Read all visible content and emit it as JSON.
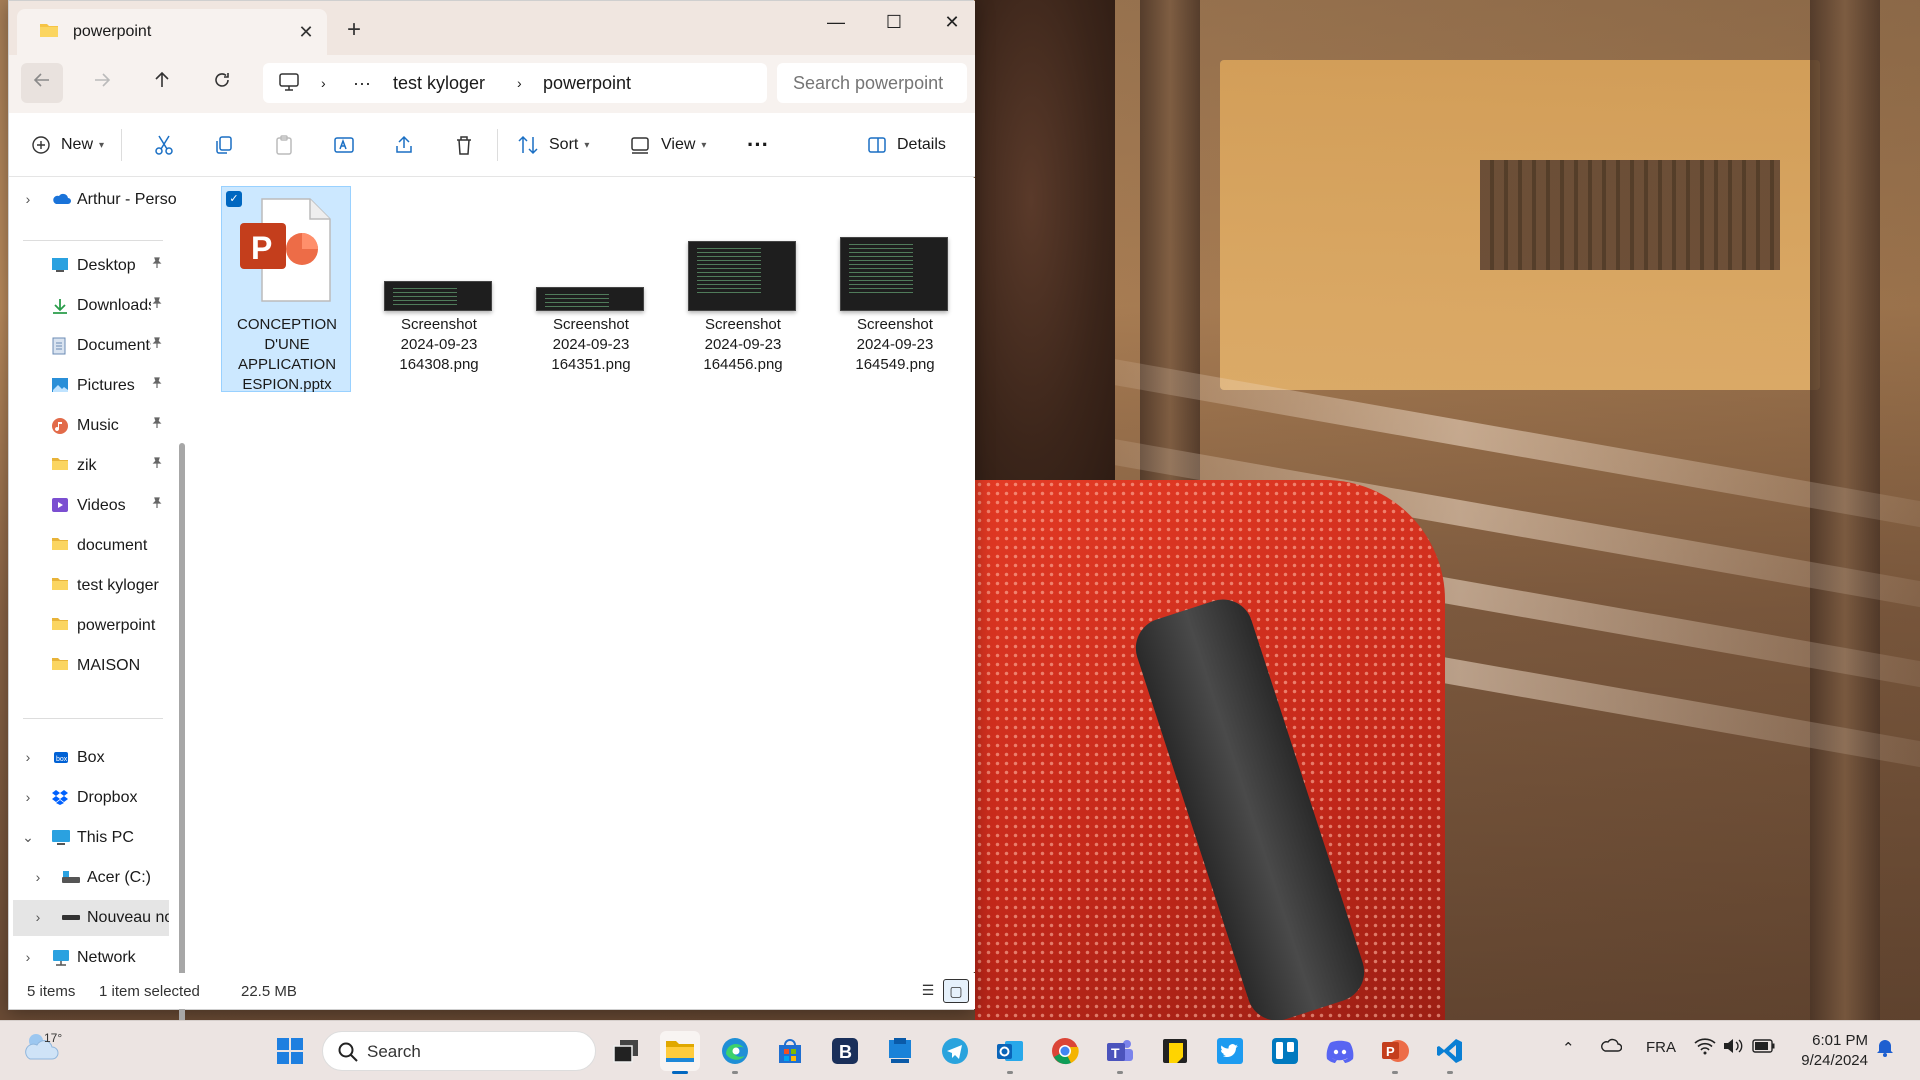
{
  "window": {
    "tab_title": "powerpoint",
    "close_tab": "✕",
    "new_tab": "+",
    "minimize": "—",
    "maximize": "☐",
    "close": "✕"
  },
  "address": {
    "ellipsis": "···",
    "crumbs": [
      "test kyloger",
      "powerpoint"
    ],
    "search_placeholder": "Search powerpoint"
  },
  "commands": {
    "new_label": "New",
    "sort_label": "Sort",
    "view_label": "View",
    "more": "···",
    "details_label": "Details"
  },
  "nav": {
    "onedrive": "Arthur - Perso",
    "quick": [
      {
        "label": "Desktop",
        "pinned": true,
        "icon": "desktop-icon"
      },
      {
        "label": "Downloads",
        "pinned": true,
        "icon": "download-icon"
      },
      {
        "label": "Documents",
        "pinned": true,
        "icon": "document-icon"
      },
      {
        "label": "Pictures",
        "pinned": true,
        "icon": "pictures-icon"
      },
      {
        "label": "Music",
        "pinned": true,
        "icon": "music-icon"
      },
      {
        "label": "zik",
        "pinned": true,
        "icon": "folder-icon"
      },
      {
        "label": "Videos",
        "pinned": true,
        "icon": "videos-icon"
      },
      {
        "label": "document",
        "pinned": false,
        "icon": "folder-icon"
      },
      {
        "label": "test kyloger",
        "pinned": false,
        "icon": "folder-icon"
      },
      {
        "label": "powerpoint",
        "pinned": false,
        "icon": "folder-icon"
      },
      {
        "label": "MAISON",
        "pinned": false,
        "icon": "folder-icon"
      }
    ],
    "box": "Box",
    "dropbox": "Dropbox",
    "thispc": "This PC",
    "drive_c": "Acer (C:)",
    "drive_new": "Nouveau no",
    "network": "Network"
  },
  "files": [
    {
      "name_lines": [
        "CONCEPTION",
        "D'UNE",
        "APPLICATION",
        "ESPION.pptx"
      ],
      "type": "pptx",
      "selected": true
    },
    {
      "name_lines": [
        "Screenshot",
        "2024-09-23",
        "164308.png"
      ],
      "type": "png",
      "selected": false
    },
    {
      "name_lines": [
        "Screenshot",
        "2024-09-23",
        "164351.png"
      ],
      "type": "png",
      "selected": false
    },
    {
      "name_lines": [
        "Screenshot",
        "2024-09-23",
        "164456.png"
      ],
      "type": "png",
      "selected": false
    },
    {
      "name_lines": [
        "Screenshot",
        "2024-09-23",
        "164549.png"
      ],
      "type": "png",
      "selected": false
    }
  ],
  "status": {
    "items": "5 items",
    "selected": "1 item selected",
    "size": "22.5 MB"
  },
  "taskbar": {
    "temperature": "17°",
    "search_label": "Search",
    "apps": [
      "start",
      "search",
      "task-view",
      "file-explorer",
      "edge",
      "store",
      "bing-b",
      "app-blue",
      "telegram",
      "outlook",
      "chrome",
      "teams",
      "sticky-notes",
      "twitter",
      "trello",
      "discord",
      "powerpoint",
      "vscode"
    ],
    "language": "FRA",
    "time": "6:01 PM",
    "date": "9/24/2024"
  }
}
